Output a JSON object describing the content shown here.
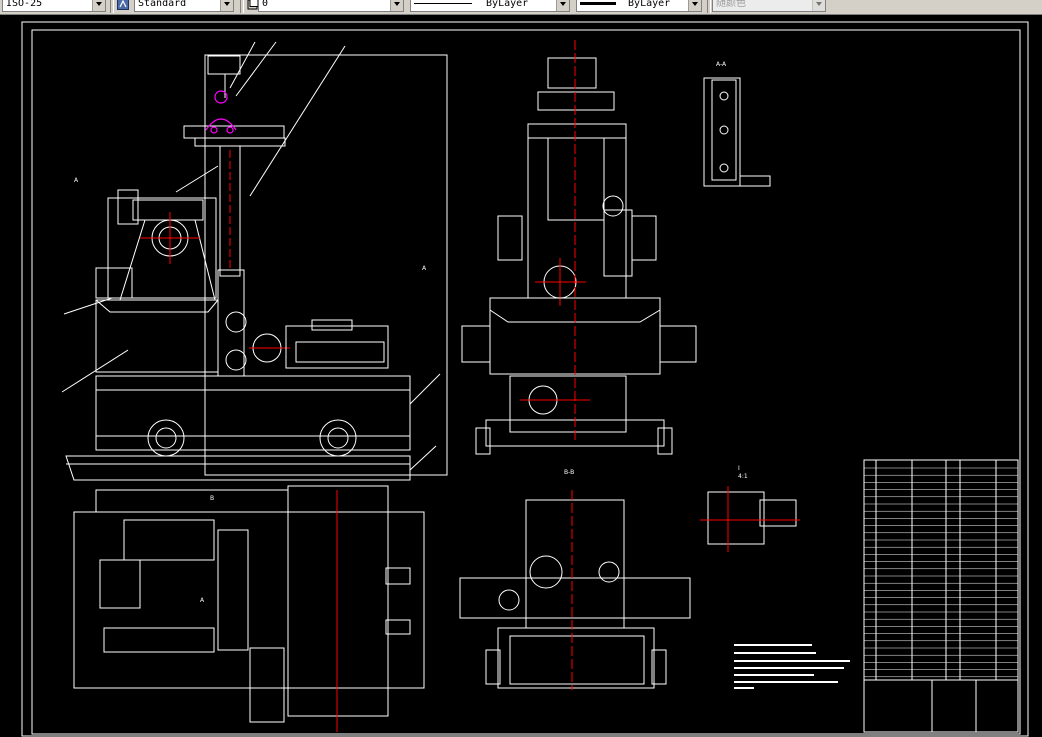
{
  "toolbar": {
    "dimstyle_value": "ISO-25",
    "textstyle_value": "Standard",
    "layer_value": "0",
    "linetype_value": "ByLayer",
    "lineweight_value": "ByLayer",
    "plotstyle_value": "随颜色"
  },
  "colors": {
    "background": "#000000",
    "linework": "#ffffff",
    "centerline": "#ff0000",
    "highlight": "#ff00ff"
  },
  "icons": [
    "textstyle-icon",
    "layer-icon",
    "linetype-swatch-icon",
    "lineweight-swatch-icon"
  ],
  "drawing": {
    "section_labels": [
      "A",
      "B",
      "A",
      "A",
      "B-B",
      "A-A",
      "I"
    ],
    "detail_scale": "4:1"
  }
}
